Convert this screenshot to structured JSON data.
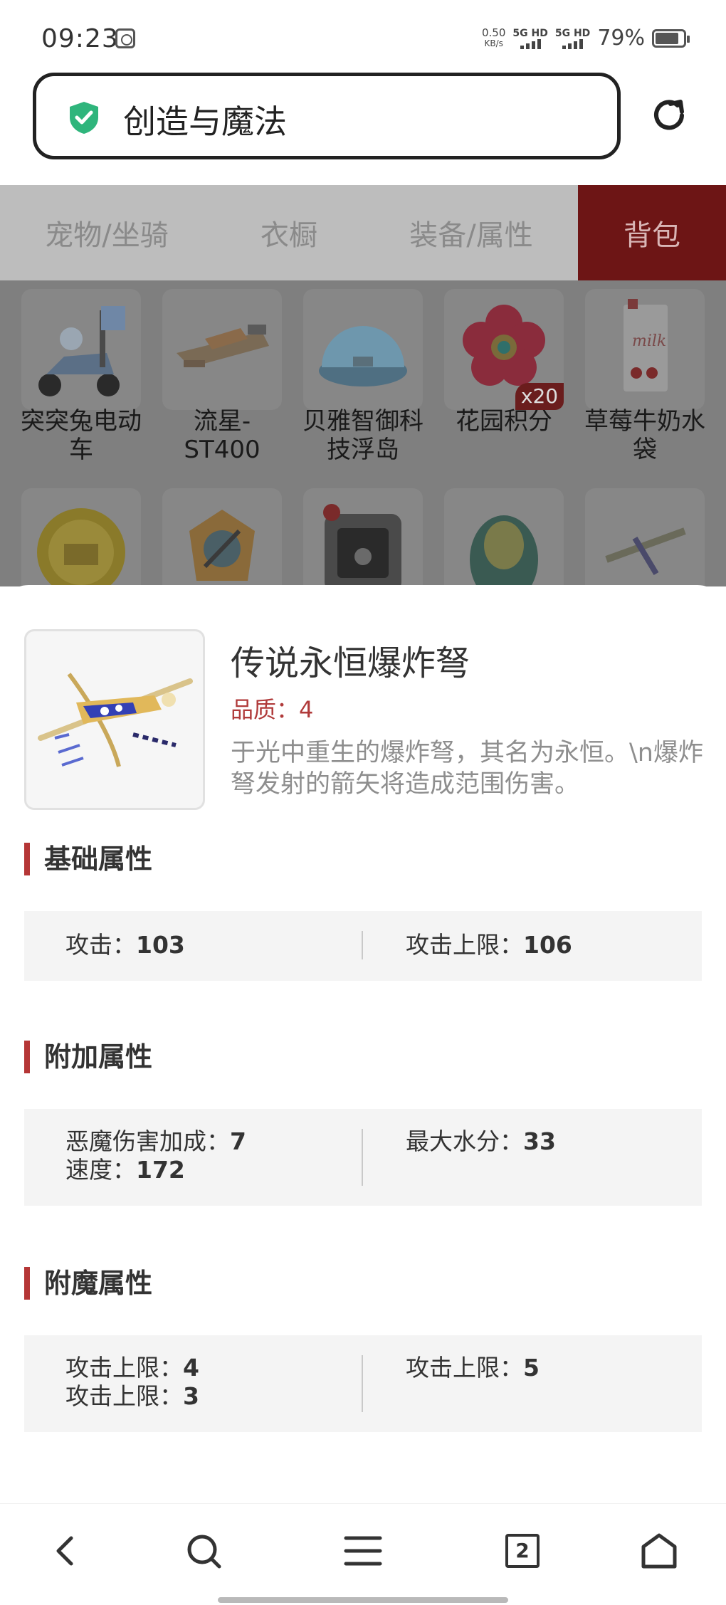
{
  "status_bar": {
    "time": "09:23",
    "net_speed_value": "0.50",
    "net_speed_unit": "KB/s",
    "sim1": "5G HD",
    "sim2": "5G HD",
    "battery": "79%"
  },
  "address_bar": {
    "title": "创造与魔法"
  },
  "tabs": [
    {
      "label": "宠物/坐骑",
      "active": false
    },
    {
      "label": "衣橱",
      "active": false
    },
    {
      "label": "装备/属性",
      "active": false
    },
    {
      "label": "背包",
      "active": true
    }
  ],
  "inventory": {
    "row1": [
      {
        "name_line1": "突突兔电动",
        "name_line2": "车"
      },
      {
        "name_line1": "流星-",
        "name_line2": "ST400"
      },
      {
        "name_line1": "贝雅智御科",
        "name_line2": "技浮岛"
      },
      {
        "name_line1": "花园积分",
        "name_line2": ""
      },
      {
        "name_line1": "草莓牛奶水",
        "name_line2": "袋"
      }
    ],
    "badge": "x20",
    "milk_text": "milk"
  },
  "detail": {
    "name": "传说永恒爆炸弩",
    "quality": "品质：4",
    "description": "于光中重生的爆炸弩，其名为永恒。\\n爆炸弩发射的箭矢将造成范围伤害。"
  },
  "sections": {
    "base": {
      "title": "基础属性",
      "left": [
        {
          "label": "攻击：",
          "value": "103"
        }
      ],
      "right": [
        {
          "label": "攻击上限：",
          "value": "106"
        }
      ]
    },
    "extra": {
      "title": "附加属性",
      "left": [
        {
          "label": "恶魔伤害加成：",
          "value": "7"
        },
        {
          "label": "速度：",
          "value": "172"
        }
      ],
      "right": [
        {
          "label": "最大水分：",
          "value": "33"
        }
      ]
    },
    "enchant": {
      "title": "附魔属性",
      "left": [
        {
          "label": "攻击上限：",
          "value": "4"
        },
        {
          "label": "攻击上限：",
          "value": "3"
        }
      ],
      "right": [
        {
          "label": "攻击上限：",
          "value": "5"
        }
      ]
    }
  },
  "bottom_nav": {
    "tab_count": "2",
    "icons": [
      "back-icon",
      "search-icon",
      "menu-icon",
      "tabs-icon",
      "home-icon"
    ]
  },
  "colors": {
    "accent": "#b53636",
    "active_tab_bg": "#6d1515",
    "shield": "#2fb57c"
  }
}
